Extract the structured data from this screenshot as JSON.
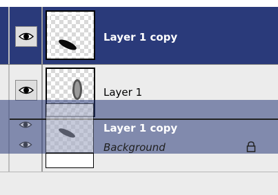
{
  "layers": [
    {
      "name": "Layer 1 copy",
      "selected": true,
      "visible": true
    },
    {
      "name": "Layer 1",
      "selected": false,
      "visible": true
    }
  ],
  "drag_ghost": {
    "primary_name": "Layer 1 copy",
    "secondary_name": "Background"
  },
  "colors": {
    "selection": "#2a3a7a",
    "panel": "#ececec"
  },
  "icons": {
    "visibility": "eye-icon",
    "lock": "lock-icon"
  }
}
